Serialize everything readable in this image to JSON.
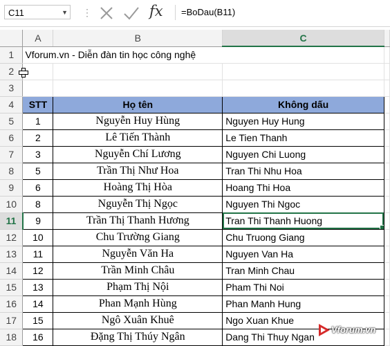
{
  "formula_bar": {
    "name_box": "C11",
    "formula": "=BoDau(B11)",
    "fx_label": "fx"
  },
  "columns": [
    "A",
    "B",
    "C"
  ],
  "active_column": "C",
  "active_row": "11",
  "row_numbers": [
    "1",
    "2",
    "3",
    "4",
    "5",
    "6",
    "7",
    "8",
    "9",
    "10",
    "11",
    "12",
    "13",
    "14",
    "15",
    "16",
    "17",
    "18"
  ],
  "title_cell": "Vforum.vn - Diễn đàn tin học công nghệ",
  "table_headers": {
    "stt": "STT",
    "ho_ten": "Họ tên",
    "khong_dau": "Không dấu"
  },
  "rows": [
    {
      "row": "5",
      "stt": "1",
      "name": "Nguyễn Huy Hùng",
      "plain": "Nguyen Huy Hung"
    },
    {
      "row": "6",
      "stt": "2",
      "name": "Lê Tiến Thành",
      "plain": "Le Tien Thanh"
    },
    {
      "row": "7",
      "stt": "3",
      "name": "Nguyễn Chí Lương",
      "plain": "Nguyen Chi Luong"
    },
    {
      "row": "8",
      "stt": "5",
      "name": "Trần Thị Như Hoa",
      "plain": "Tran Thi Nhu Hoa"
    },
    {
      "row": "9",
      "stt": "6",
      "name": "Hoàng Thị Hòa",
      "plain": "Hoang Thi Hoa"
    },
    {
      "row": "10",
      "stt": "8",
      "name": "Nguyễn Thị Ngọc",
      "plain": "Nguyen Thi Ngoc"
    },
    {
      "row": "11",
      "stt": "9",
      "name": "Trần Thị Thanh Hương",
      "plain": "Tran Thi Thanh Huong"
    },
    {
      "row": "12",
      "stt": "10",
      "name": "Chu Trường Giang",
      "plain": "Chu Truong Giang"
    },
    {
      "row": "13",
      "stt": "11",
      "name": "Nguyễn Văn Ha",
      "plain": "Nguyen Van Ha"
    },
    {
      "row": "14",
      "stt": "12",
      "name": "Trần Minh Châu",
      "plain": "Tran Minh Chau"
    },
    {
      "row": "15",
      "stt": "13",
      "name": "Phạm Thị Nội",
      "plain": "Pham Thi Noi"
    },
    {
      "row": "16",
      "stt": "14",
      "name": "Phan Mạnh Hùng",
      "plain": "Phan Manh Hung"
    },
    {
      "row": "17",
      "stt": "15",
      "name": "Ngô  Xuân Khuê",
      "plain": "Ngo  Xuan Khue"
    },
    {
      "row": "18",
      "stt": "16",
      "name": "Đặng Thị Thúy Ngân",
      "plain": "Dang Thi Thuy Ngan"
    }
  ],
  "watermark": "Vforum.vn",
  "accent_color": "#217346",
  "header_fill_color": "#8ea9db"
}
